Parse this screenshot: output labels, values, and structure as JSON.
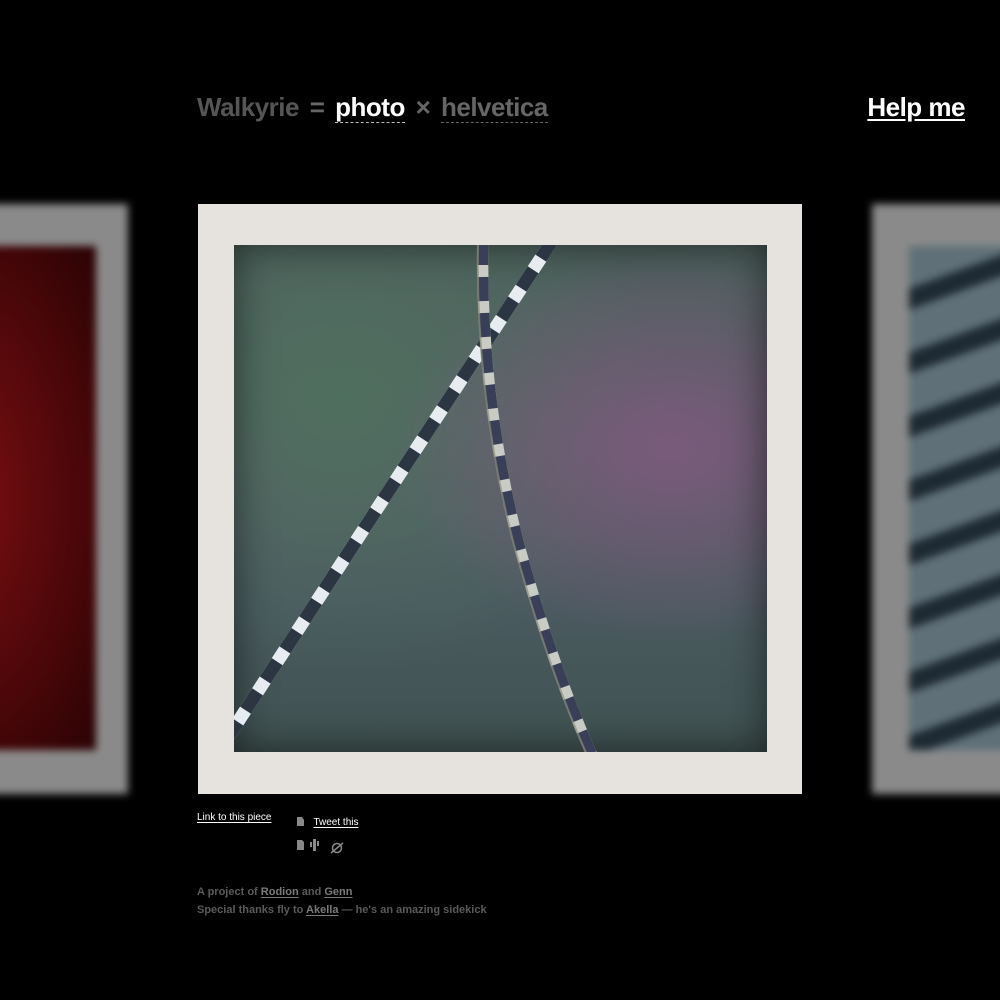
{
  "header": {
    "brand": "Walkyrie",
    "equals": "=",
    "photo_label": "photo",
    "times": "×",
    "helvetica_label": "helvetica",
    "help_label": "Help me"
  },
  "actions": {
    "link_label": "Link to this piece",
    "tweet_label": "Tweet this"
  },
  "footer": {
    "line1_prefix": "A project of",
    "author1": "Rodion",
    "and": "and",
    "author2": "Genn",
    "line2_prefix": "Special thanks fly to",
    "helper": "Akella",
    "line2_suffix": "— he's an amazing sidekick"
  },
  "icons": [
    "document-icon",
    "cactus-icon",
    "no-link-icon"
  ],
  "colors": {
    "background": "#000000",
    "polaroid_frame": "#e6e3df",
    "title_muted": "#555555",
    "link": "#ffffff"
  }
}
